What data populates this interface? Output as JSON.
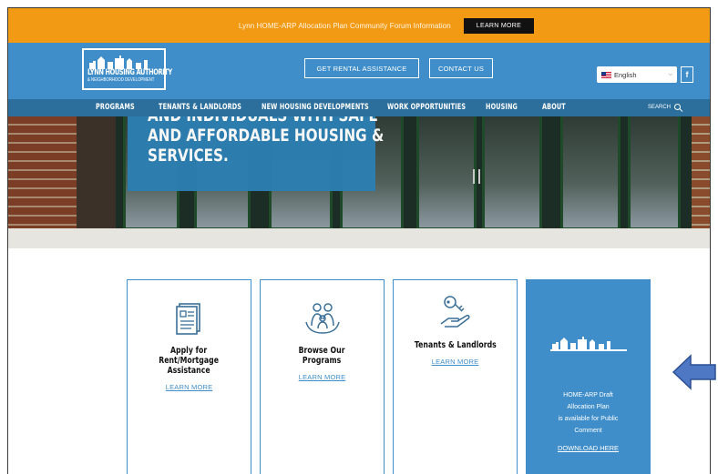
{
  "announcement": {
    "text": "Lynn HOME-ARP Allocation Plan Community Forum Information",
    "button": "LEARN MORE"
  },
  "header": {
    "logo_line1": "LYNN HOUSING AUTHORITY",
    "logo_line2": "& NEIGHBORHOOD DEVELOPMENT",
    "rent_button": "GET RENTAL ASSISTANCE",
    "contact_button": "CONTACT US",
    "language": "English",
    "facebook": "f"
  },
  "nav": {
    "items": [
      "PROGRAMS",
      "TENANTS & LANDLORDS",
      "NEW HOUSING DEVELOPMENTS",
      "WORK OPPORTUNITIES",
      "HOUSING",
      "ABOUT"
    ],
    "search": "SEARCH"
  },
  "hero": {
    "line0": "AND INDIVIDUALS WITH SAFE",
    "line1": "AND AFFORDABLE HOUSING &",
    "line2": "SERVICES."
  },
  "cards": [
    {
      "title1": "Apply for",
      "title2": "Rent/Mortgage",
      "title3": "Assistance",
      "link": "LEARN MORE",
      "icon": "document-icon"
    },
    {
      "title1": "Browse Our",
      "title2": "Programs",
      "link": "LEARN MORE",
      "icon": "family-icon"
    },
    {
      "title1": "Tenants & Landlords",
      "link": "LEARN MORE",
      "icon": "key-hand-icon"
    }
  ],
  "promo": {
    "line1": "HOME-ARP Draft",
    "line2": "Allocation Plan",
    "line3": "is available for Public",
    "line4": "Comment",
    "link": "DOWNLOAD HERE"
  },
  "colors": {
    "announce": "#f39a14",
    "header": "#3f8ec9",
    "nav": "#2c6f9c",
    "accent": "#3f8ec9"
  }
}
